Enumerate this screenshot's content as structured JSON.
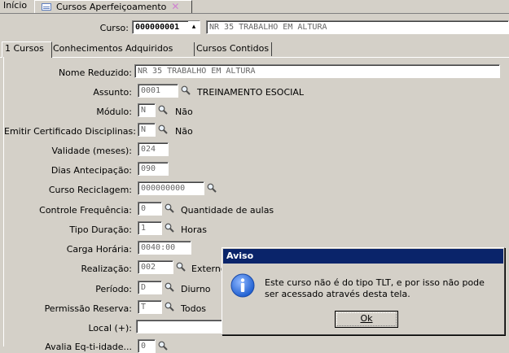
{
  "top_tabs": {
    "home_label": "Início",
    "active_label": "Cursos Aperfeiçoamento",
    "close_glyph": "✕"
  },
  "curso": {
    "label": "Curso:",
    "code": "000000001",
    "name": "NR 35 TRABALHO EM ALTURA"
  },
  "tabs": [
    {
      "label": "1 Cursos"
    },
    {
      "label": "Conhecimentos Adquiridos"
    },
    {
      "label": "Cursos Contidos"
    }
  ],
  "form": {
    "nome_reduzido": {
      "label": "Nome Reduzido:",
      "value": "NR 35 TRABALHO EM ALTURA"
    },
    "assunto": {
      "label": "Assunto:",
      "value": "0001",
      "desc": "TREINAMENTO ESOCIAL"
    },
    "modulo": {
      "label": "Módulo:",
      "value": "N",
      "desc": "Não"
    },
    "emitir_certificado": {
      "label": "Emitir Certificado Disciplinas:",
      "value": "N",
      "desc": "Não"
    },
    "validade": {
      "label": "Validade (meses):",
      "value": "024"
    },
    "dias_antecipacao": {
      "label": "Dias Antecipação:",
      "value": "090"
    },
    "curso_reciclagem": {
      "label": "Curso Reciclagem:",
      "value": "000000000"
    },
    "controle_frequencia": {
      "label": "Controle Frequência:",
      "value": "0",
      "desc": "Quantidade de aulas"
    },
    "tipo_duracao": {
      "label": "Tipo Duração:",
      "value": "1",
      "desc": "Horas"
    },
    "carga_horaria": {
      "label": "Carga Horária:",
      "value": "0040:00"
    },
    "realizacao": {
      "label": "Realização:",
      "value": "002",
      "desc": "Externo"
    },
    "periodo": {
      "label": "Período:",
      "value": "D",
      "desc": "Diurno"
    },
    "permissao_reserva": {
      "label": "Permissão Reserva:",
      "value": "T",
      "desc": "Todos"
    },
    "local": {
      "label": "Local (+):",
      "value": ""
    },
    "partial_label": "Avalia Eq-ti-idade...",
    "partial_value": "0"
  },
  "dialog": {
    "title": "Aviso",
    "message": "Este curso não é do tipo TLT, e por isso não pode ser acessado através desta tela.",
    "ok_label": "Ok"
  },
  "colors": {
    "window_bg": "#d4d0c8",
    "title_bar": "#0a246a",
    "info_icon": "#1f5fd0"
  }
}
